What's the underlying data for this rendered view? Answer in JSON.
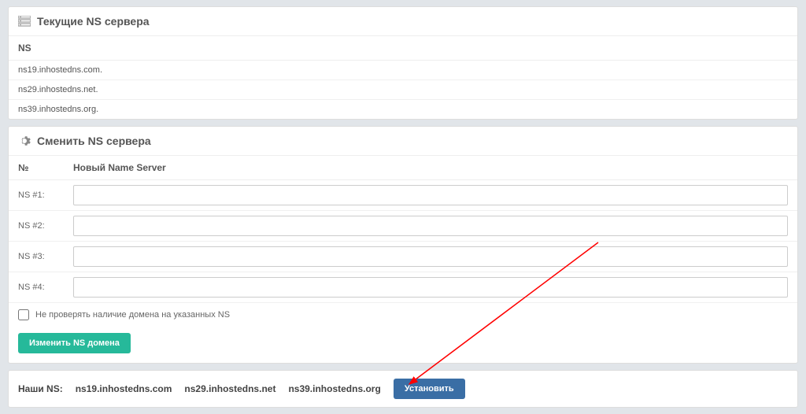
{
  "current_ns": {
    "title": "Текущие NS сервера",
    "column_header": "NS",
    "rows": [
      "ns19.inhostedns.com.",
      "ns29.inhostedns.net.",
      "ns39.inhostedns.org."
    ]
  },
  "change_ns": {
    "title": "Сменить NS сервера",
    "col_num": "№",
    "col_name": "Новый Name Server",
    "rows": [
      {
        "label": "NS #1:",
        "value": ""
      },
      {
        "label": "NS #2:",
        "value": ""
      },
      {
        "label": "NS #3:",
        "value": ""
      },
      {
        "label": "NS #4:",
        "value": ""
      }
    ],
    "checkbox_label": "Не проверять наличие домена на указанных NS",
    "submit_label": "Изменить NS домена"
  },
  "footer": {
    "label": "Наши NS:",
    "servers": [
      "ns19.inhostedns.com",
      "ns29.inhostedns.net",
      "ns39.inhostedns.org"
    ],
    "install_label": "Установить"
  }
}
